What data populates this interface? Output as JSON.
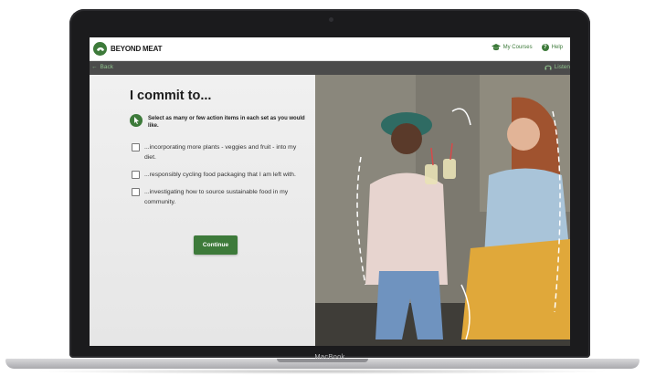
{
  "app": {
    "brand": "BEYOND MEAT",
    "nav": {
      "my_courses": "My Courses",
      "help": "Help"
    },
    "back": "Back",
    "listen": "Listen"
  },
  "content": {
    "title": "I commit to...",
    "instruction": "Select as many or few action items in each set as you would like.",
    "items": [
      {
        "label": "...incorporating more plants - veggies and fruit - into my diet.",
        "checked": false
      },
      {
        "label": "...responsibly cycling food packaging that I am left with.",
        "checked": false
      },
      {
        "label": "...investigating how to source sustainable food in my community.",
        "checked": false
      }
    ],
    "continue_label": "Continue"
  },
  "device": {
    "label": "MacBook"
  },
  "colors": {
    "accent": "#3d7a3a",
    "subbar": "#4b4b4b",
    "link": "#8fc08c"
  },
  "icons": [
    "beyond-meat-logo-icon",
    "graduation-cap-icon",
    "help-icon",
    "arrow-left-icon",
    "headphones-icon",
    "pointer-icon"
  ]
}
